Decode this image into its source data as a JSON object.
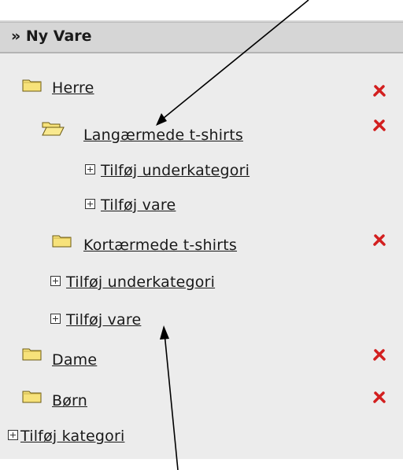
{
  "panel": {
    "title": "» Ny Vare"
  },
  "tree": {
    "herre": {
      "label": "Herre",
      "delete_icon": "delete-icon"
    },
    "langaermede": {
      "label": "Langærmede t-shirts",
      "delete_icon": "delete-icon"
    },
    "lang_add_sub": {
      "label": "Tilføj underkategori"
    },
    "lang_add_item": {
      "label": "Tilføj vare"
    },
    "kortaermede": {
      "label": "Kortærmede t-shirts",
      "delete_icon": "delete-icon"
    },
    "herre_add_sub": {
      "label": "Tilføj underkategori"
    },
    "herre_add_item": {
      "label": "Tilføj vare"
    },
    "dame": {
      "label": "Dame",
      "delete_icon": "delete-icon"
    },
    "born": {
      "label": "Børn",
      "delete_icon": "delete-icon"
    },
    "add_category": {
      "label": "Tilføj kategori"
    }
  },
  "icons": {
    "folder": "folder-icon",
    "folder_open": "folder-open-icon",
    "expand": "plus-box-icon",
    "delete": "delete-icon"
  },
  "colors": {
    "panel_bg": "#ececec",
    "header_bg": "#d6d6d6",
    "delete_red": "#d21f1f",
    "folder_yellow": "#f7e27a"
  }
}
